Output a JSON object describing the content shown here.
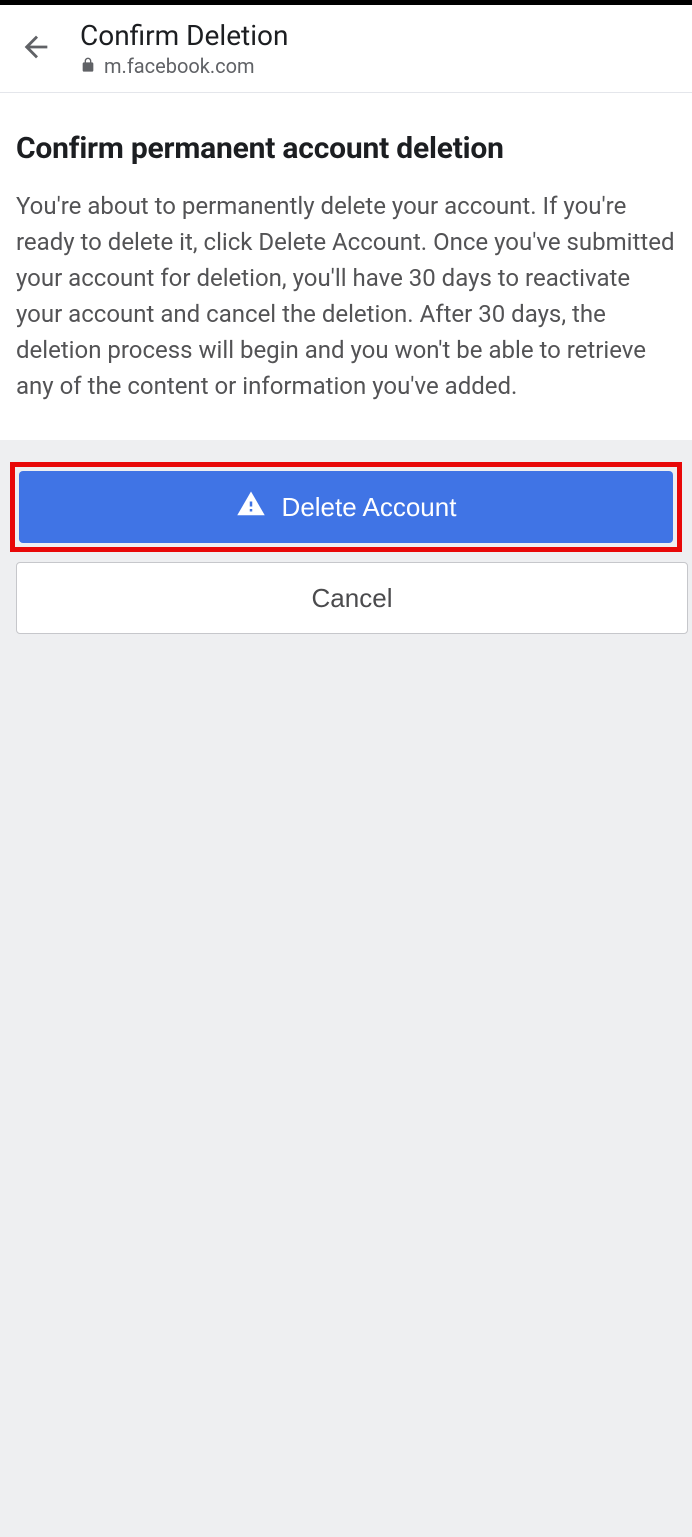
{
  "header": {
    "title": "Confirm Deletion",
    "url": "m.facebook.com"
  },
  "main": {
    "heading": "Confirm permanent account deletion",
    "description": "You're about to permanently delete your account. If you're ready to delete it, click Delete Account. Once you've submitted your account for deletion, you'll have 30 days to reactivate your account and cancel the deletion. After 30 days, the deletion process will begin and you won't be able to retrieve any of the content or information you've added."
  },
  "buttons": {
    "delete": "Delete Account",
    "cancel": "Cancel"
  }
}
